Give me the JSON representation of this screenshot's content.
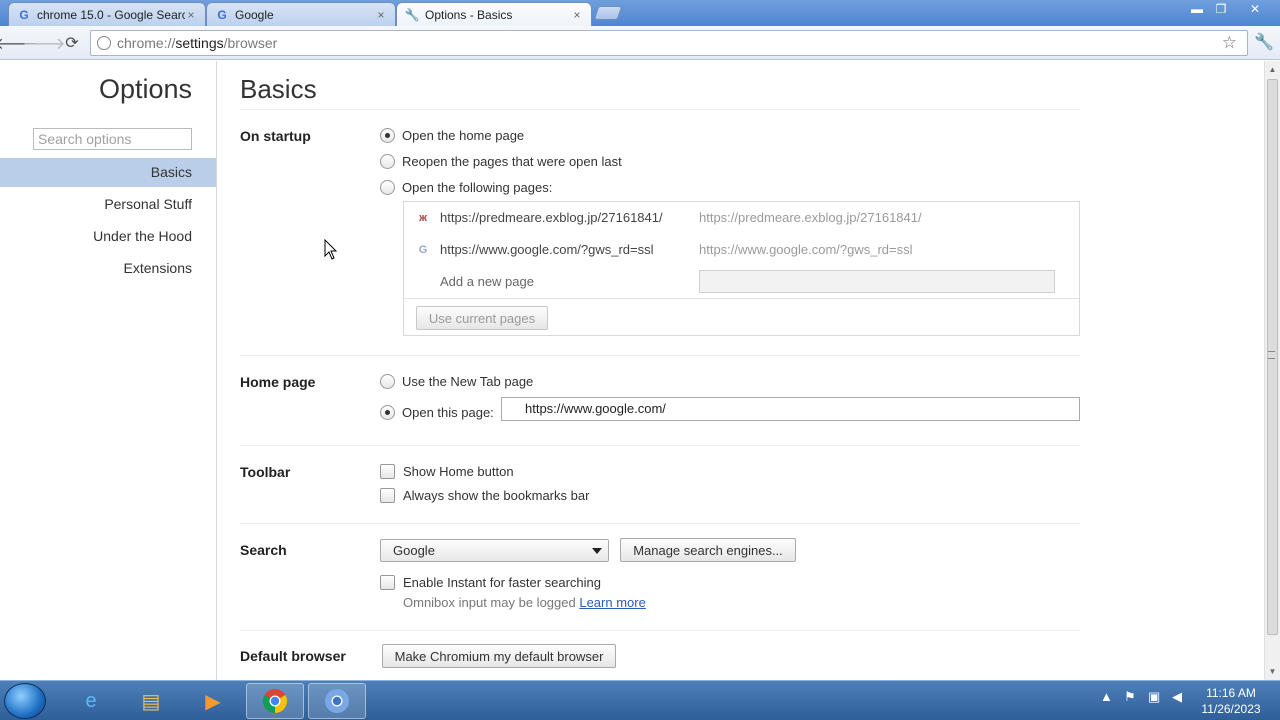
{
  "tabs": [
    {
      "title": "chrome 15.0 - Google Searc",
      "favicon": "google-g-icon"
    },
    {
      "title": "Google",
      "favicon": "google-g-icon"
    },
    {
      "title": "Options - Basics",
      "favicon": "wrench-icon"
    }
  ],
  "tab_close": "×",
  "window_controls": {
    "minimize": "▬",
    "restore": "❐",
    "close": "✕"
  },
  "toolbar": {
    "back": "🡐",
    "forward": "🡒",
    "reload": "⟳",
    "url_scheme": "chrome://",
    "url_host": "settings",
    "url_path": "/browser",
    "star": "☆",
    "wrench": "🔧"
  },
  "sidebar": {
    "title": "Options",
    "search_placeholder": "Search options",
    "items": [
      {
        "label": "Basics",
        "selected": true
      },
      {
        "label": "Personal Stuff"
      },
      {
        "label": "Under the Hood"
      },
      {
        "label": "Extensions"
      }
    ]
  },
  "main": {
    "title": "Basics",
    "startup": {
      "title": "On startup",
      "options": [
        "Open the home page",
        "Reopen the pages that were open last",
        "Open the following pages:"
      ],
      "selected": 0,
      "pages": [
        {
          "url": "https://predmeare.exblog.jp/27161841/",
          "url2": "https://predmeare.exblog.jp/27161841/",
          "icon": "exblog-icon"
        },
        {
          "url": "https://www.google.com/?gws_rd=ssl",
          "url2": "https://www.google.com/?gws_rd=ssl",
          "icon": "google-g-icon"
        }
      ],
      "add_page_label": "Add a new page",
      "use_current_button": "Use current pages"
    },
    "home_page": {
      "title": "Home page",
      "option_newtab": "Use the New Tab page",
      "option_open": "Open this page:",
      "url": "https://www.google.com/"
    },
    "toolbar_section": {
      "title": "Toolbar",
      "show_home": "Show Home button",
      "show_bookmarks": "Always show the bookmarks bar"
    },
    "search": {
      "title": "Search",
      "engine": "Google",
      "manage_button": "Manage search engines...",
      "instant_label": "Enable Instant for faster searching",
      "note": "Omnibox input may be logged",
      "learn_more": "Learn more"
    },
    "default_browser": {
      "title": "Default browser",
      "button": "Make Chromium my default browser"
    }
  },
  "taskbar": {
    "clock_time": "11:16 AM",
    "clock_date": "11/26/2023"
  }
}
